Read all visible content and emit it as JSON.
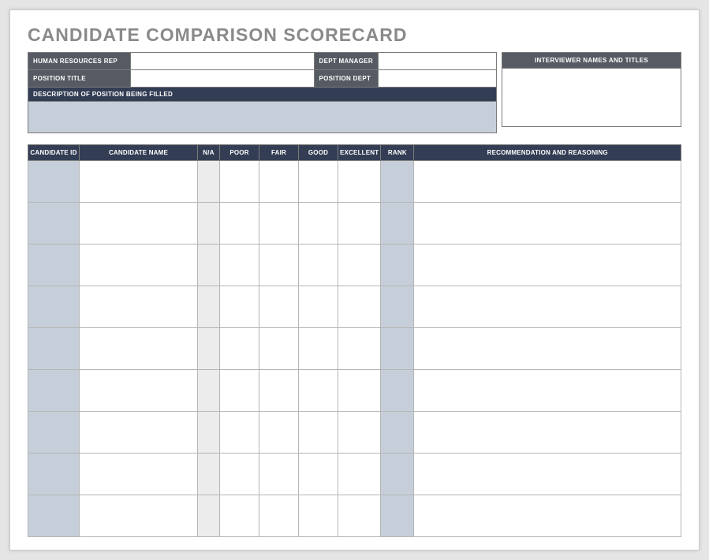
{
  "title": "CANDIDATE COMPARISON SCORECARD",
  "labels": {
    "hr_rep": "HUMAN RESOURCES REP",
    "dept_manager": "DEPT MANAGER",
    "position_title": "POSITION TITLE",
    "position_dept": "POSITION DEPT",
    "description": "DESCRIPTION OF POSITION BEING FILLED",
    "interviewer": "INTERVIEWER NAMES AND TITLES"
  },
  "values": {
    "hr_rep": "",
    "dept_manager": "",
    "position_title": "",
    "position_dept": "",
    "description": "",
    "interviewer": ""
  },
  "grid_headers": {
    "id": "CANDIDATE ID",
    "name": "CANDIDATE NAME",
    "na": "N/A",
    "poor": "POOR",
    "fair": "FAIR",
    "good": "GOOD",
    "excellent": "EXCELLENT",
    "rank": "RANK",
    "rec": "RECOMMENDATION AND REASONING"
  },
  "rows": [
    {
      "id": "",
      "name": "",
      "na": "",
      "poor": "",
      "fair": "",
      "good": "",
      "excellent": "",
      "rank": "",
      "rec": ""
    },
    {
      "id": "",
      "name": "",
      "na": "",
      "poor": "",
      "fair": "",
      "good": "",
      "excellent": "",
      "rank": "",
      "rec": ""
    },
    {
      "id": "",
      "name": "",
      "na": "",
      "poor": "",
      "fair": "",
      "good": "",
      "excellent": "",
      "rank": "",
      "rec": ""
    },
    {
      "id": "",
      "name": "",
      "na": "",
      "poor": "",
      "fair": "",
      "good": "",
      "excellent": "",
      "rank": "",
      "rec": ""
    },
    {
      "id": "",
      "name": "",
      "na": "",
      "poor": "",
      "fair": "",
      "good": "",
      "excellent": "",
      "rank": "",
      "rec": ""
    },
    {
      "id": "",
      "name": "",
      "na": "",
      "poor": "",
      "fair": "",
      "good": "",
      "excellent": "",
      "rank": "",
      "rec": ""
    },
    {
      "id": "",
      "name": "",
      "na": "",
      "poor": "",
      "fair": "",
      "good": "",
      "excellent": "",
      "rank": "",
      "rec": ""
    },
    {
      "id": "",
      "name": "",
      "na": "",
      "poor": "",
      "fair": "",
      "good": "",
      "excellent": "",
      "rank": "",
      "rec": ""
    },
    {
      "id": "",
      "name": "",
      "na": "",
      "poor": "",
      "fair": "",
      "good": "",
      "excellent": "",
      "rank": "",
      "rec": ""
    }
  ]
}
